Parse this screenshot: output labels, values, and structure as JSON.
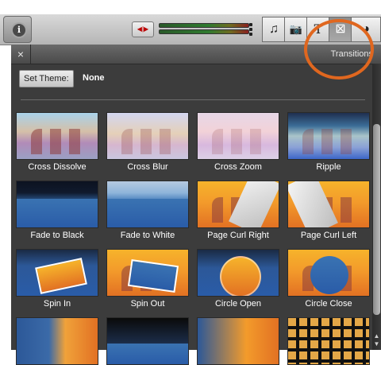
{
  "toolbar": {
    "info_glyph": "i",
    "audio_glyph": "◀|▶",
    "segments": [
      {
        "icon": "music-icon",
        "glyph": "♫"
      },
      {
        "icon": "camera-icon",
        "glyph": "📷"
      },
      {
        "icon": "text-icon",
        "glyph": "T"
      },
      {
        "icon": "transitions-icon",
        "glyph": "⊠"
      },
      {
        "icon": "globe-icon",
        "glyph": "◕"
      }
    ],
    "active_segment": "transitions-icon"
  },
  "panel": {
    "close_glyph": "×",
    "title": "Transitions",
    "set_theme_label": "Set Theme:",
    "theme_value": "None"
  },
  "transitions": [
    "Cross Dissolve",
    "Cross Blur",
    "Cross Zoom",
    "Ripple",
    "Fade to Black",
    "Fade to White",
    "Page Curl Right",
    "Page Curl Left",
    "Spin In",
    "Spin Out",
    "Circle Open",
    "Circle Close"
  ],
  "colors": {
    "highlight_ring": "#e0671f",
    "panel_bg": "#3c3c3c"
  }
}
